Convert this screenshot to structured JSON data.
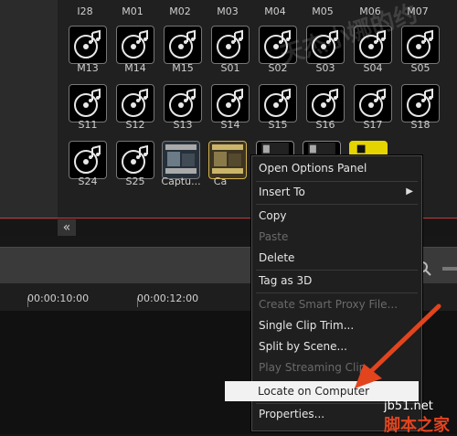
{
  "library": {
    "top_labels": [
      "I28",
      "M01",
      "M02",
      "M03",
      "M04",
      "M05",
      "M06",
      "M07"
    ],
    "row1": [
      "M13",
      "M14",
      "M15",
      "S01",
      "S02",
      "S03",
      "S04",
      "S05"
    ],
    "row2": [
      "S11",
      "S12",
      "S13",
      "S14",
      "S15",
      "S16",
      "S17",
      "S18"
    ],
    "row3": [
      "S24",
      "S25",
      "Captu...",
      "Ca"
    ]
  },
  "timeline": {
    "timecodes": [
      "00:00:10:00",
      "00:00:12:00"
    ]
  },
  "context_menu": {
    "items": [
      {
        "label": "Open Options Panel",
        "enabled": true
      },
      {
        "label": "Insert To",
        "enabled": true,
        "submenu": true
      },
      {
        "label": "Copy",
        "enabled": true
      },
      {
        "label": "Paste",
        "enabled": false
      },
      {
        "label": "Delete",
        "enabled": true
      },
      {
        "label": "Tag as 3D",
        "enabled": true
      },
      {
        "label": "Create Smart Proxy File...",
        "enabled": false
      },
      {
        "label": "Single Clip Trim...",
        "enabled": true
      },
      {
        "label": "Split by Scene...",
        "enabled": true
      },
      {
        "label": "Play Streaming Clip",
        "enabled": false
      },
      {
        "label": "Locate on Computer",
        "enabled": true,
        "highlighted": true
      },
      {
        "label": "Properties...",
        "enabled": true
      }
    ]
  },
  "watermark": {
    "text": "天 杰 小 娜 的 约"
  },
  "branding": {
    "site": "jb51.net",
    "cn": "脚本之家"
  },
  "colors": {
    "accent_red": "#c23434",
    "arrow_red": "#e2441e",
    "highlight": "#f2f2f2"
  }
}
